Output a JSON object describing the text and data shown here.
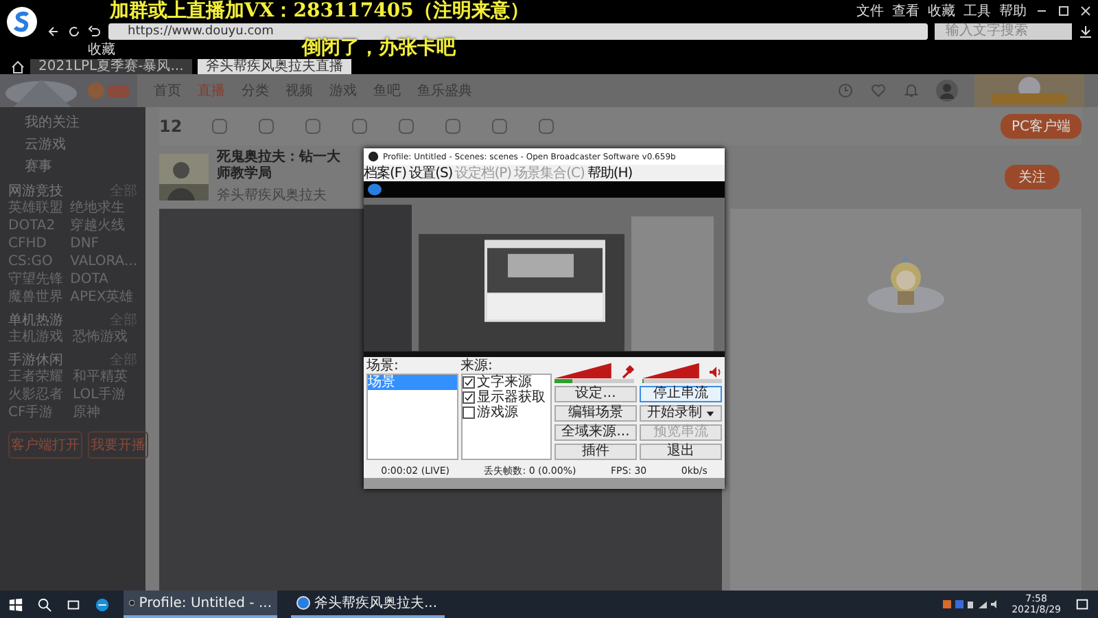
{
  "browser": {
    "menu": [
      "文件",
      "查看",
      "收藏",
      "工具",
      "帮助"
    ],
    "url": "https://www.douyu.com",
    "search": {
      "placeholder": "输入文字搜索"
    },
    "bookmarks": [
      "收藏"
    ],
    "tabs": [
      {
        "label": "2021LPL夏季赛-暴风...",
        "selected": false
      },
      {
        "label": "斧头帮疾风奥拉夫直播",
        "selected": true
      }
    ]
  },
  "overlay_text": [
    "加群或上直播加VX：283117405（注明来意）",
    "倒闭了，办张卡吧"
  ],
  "site": {
    "nav": [
      {
        "label": "首页",
        "selected": false
      },
      {
        "label": "直播",
        "selected": true
      },
      {
        "label": "分类",
        "selected": false
      },
      {
        "label": "视频",
        "selected": false
      },
      {
        "label": "游戏",
        "selected": false
      },
      {
        "label": "鱼吧",
        "selected": false
      },
      {
        "label": "鱼乐盛典",
        "selected": false
      }
    ],
    "client_button": "PC客户端",
    "counter": "12",
    "sidebar": {
      "items": [
        "我的关注",
        "云游戏",
        "赛事"
      ],
      "sections": [
        {
          "title": "网游竞技",
          "more": "全部",
          "items": [
            "英雄联盟",
            "绝地求生",
            "DOTA2",
            "穿越火线",
            "CFHD",
            "DNF",
            "CS:GO",
            "VALORA...",
            "守望先锋",
            "DOTA",
            "魔兽世界",
            "APEX英雄"
          ]
        },
        {
          "title": "单机热游",
          "more": "全部",
          "items": [
            "主机游戏",
            "恐怖游戏"
          ]
        },
        {
          "title": "手游休闲",
          "more": "全部",
          "items": [
            "王者荣耀",
            "和平精英",
            "火影忍者",
            "LOL手游",
            "CF手游",
            "原神"
          ]
        }
      ],
      "buttons": [
        "客户端打开",
        "我要开播"
      ]
    },
    "stream": {
      "title": "死鬼奥拉夫：钻一大师教学局",
      "streamer": "斧头帮疾风奥拉夫",
      "follow": "关注"
    }
  },
  "obs": {
    "title": "Profile: Untitled - Scenes: scenes - Open Broadcaster Software v0.659b",
    "menu": [
      {
        "label": "档案(F)",
        "disabled": false
      },
      {
        "label": "设置(S)",
        "disabled": false
      },
      {
        "label": "设定档(P)",
        "disabled": true
      },
      {
        "label": "场景集合(C)",
        "disabled": true
      },
      {
        "label": "帮助(H)",
        "disabled": false
      }
    ],
    "scenes_label": "场景:",
    "scenes": [
      {
        "label": "场景",
        "selected": true
      }
    ],
    "sources_label": "来源:",
    "sources": [
      {
        "label": "文字来源",
        "checked": true
      },
      {
        "label": "显示器获取",
        "checked": true
      },
      {
        "label": "游戏源",
        "checked": false
      }
    ],
    "meters": [
      {
        "kind": "microphone",
        "level": 0.22
      },
      {
        "kind": "speaker",
        "level": 0.02
      }
    ],
    "buttons": [
      {
        "label": "设定...",
        "disabled": false,
        "focused": false,
        "kind": "plain"
      },
      {
        "label": "停止串流",
        "disabled": false,
        "focused": true,
        "kind": "plain"
      },
      {
        "label": "编辑场景",
        "disabled": false,
        "focused": false,
        "kind": "plain"
      },
      {
        "label": "开始录制",
        "disabled": false,
        "focused": false,
        "kind": "split"
      },
      {
        "label": "全域来源...",
        "disabled": false,
        "focused": false,
        "kind": "plain"
      },
      {
        "label": "预览串流",
        "disabled": true,
        "focused": false,
        "kind": "plain"
      },
      {
        "label": "插件",
        "disabled": false,
        "focused": false,
        "kind": "plain"
      },
      {
        "label": "退出",
        "disabled": false,
        "focused": false,
        "kind": "plain"
      }
    ],
    "status": [
      "0:00:02 (LIVE)",
      "丢失帧数: 0 (0.00%)",
      "FPS: 30",
      "0kb/s"
    ]
  },
  "taskbar": {
    "tasks": [
      {
        "label": "Profile: Untitled - ...",
        "kind": "obs",
        "selected": true
      },
      {
        "label": "斧头帮疾风奥拉夫...",
        "kind": "browser",
        "selected": false
      }
    ],
    "time": "7:58",
    "date": "2021/8/29"
  }
}
